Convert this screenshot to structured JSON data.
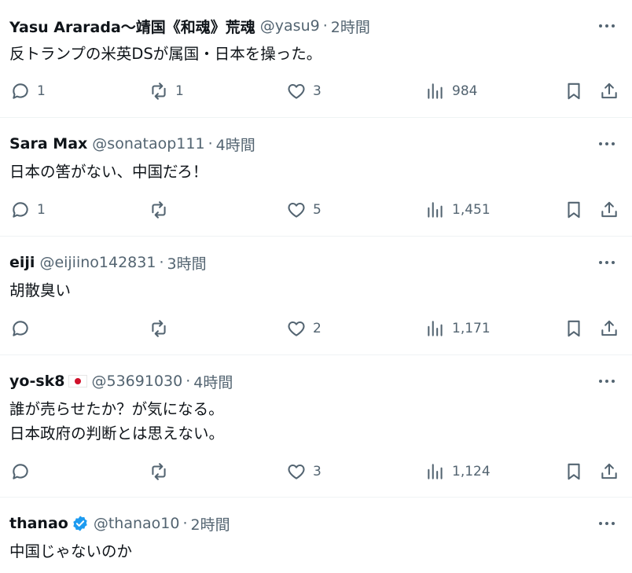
{
  "tweets": [
    {
      "name": "Yasu Ararada〜靖国《和魂》荒魂",
      "handle": "@yasu9",
      "time": "2時間",
      "text": "反トランプの米英DSが属国・日本を操った。",
      "replies": "1",
      "retweets": "1",
      "likes": "3",
      "views": "984"
    },
    {
      "name": "Sara Max",
      "handle": "@sonataop111",
      "time": "4時間",
      "text": "日本の筈がない、中国だろ！",
      "replies": "1",
      "retweets": "",
      "likes": "5",
      "views": "1,451"
    },
    {
      "name": "eiji",
      "handle": "@eijiino142831",
      "time": "3時間",
      "text": "胡散臭い",
      "replies": "",
      "retweets": "",
      "likes": "2",
      "views": "1,171"
    },
    {
      "name": "yo-sk8",
      "handle": "@53691030",
      "time": "4時間",
      "text": "誰が売らせたか？が気になる。\n日本政府の判断とは思えない。",
      "replies": "",
      "retweets": "",
      "likes": "3",
      "views": "1,124"
    },
    {
      "name": "thanao",
      "handle": "@thanao10",
      "time": "2時間",
      "text": "中国じゃないのか"
    }
  ],
  "separator": "·",
  "icons": {
    "reply": "reply-icon",
    "retweet": "retweet-icon",
    "like": "heart-icon",
    "views": "views-icon",
    "bookmark": "bookmark-icon",
    "share": "share-icon",
    "more": "more-icon",
    "flag": "japan-flag-icon",
    "verified": "verified-badge-icon"
  },
  "colors": {
    "text": "#0f1419",
    "secondary": "#536471",
    "verified": "#1d9bf0",
    "divider": "#eff3f4"
  }
}
